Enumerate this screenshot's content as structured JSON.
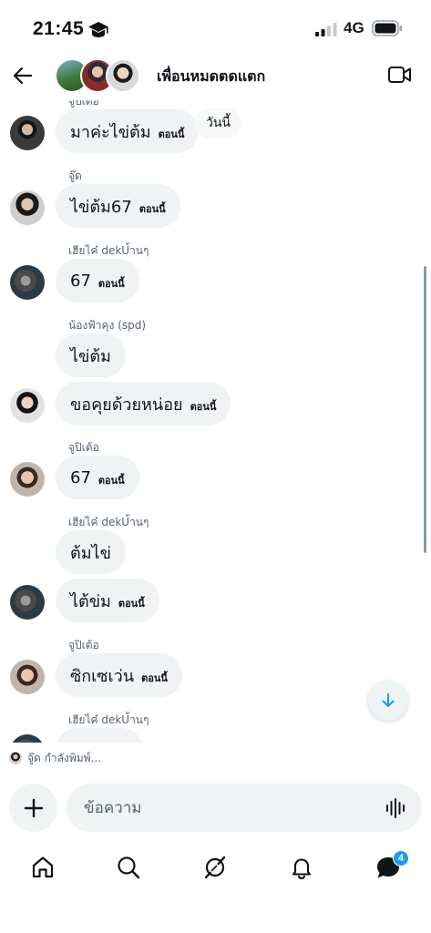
{
  "status_bar": {
    "time": "21:45",
    "network": "4G"
  },
  "header": {
    "group_name": "เพื่อนหมดตดแตก"
  },
  "messages": [
    {
      "sender": "จูปิเต้อ",
      "text": "มาค่ะไข่ต้ม",
      "time": "ตอนนี้",
      "reaction": "วันนี้"
    },
    {
      "sender": "จู๊ด",
      "text": "ไข่ต้ม67",
      "time": "ตอนนี้"
    },
    {
      "sender": "เฮียไค๋ dekU้านๆ",
      "text": "67",
      "time": "ตอนนี้"
    },
    {
      "sender": "น้องฟ้าคุง (spd)",
      "text": "ไข่ต้ม",
      "time": ""
    },
    {
      "sender": "",
      "text": "ขอคุยด้วยหน่อย",
      "time": "ตอนนี้"
    },
    {
      "sender": "จูปิเต้อ",
      "text": "67",
      "time": "ตอนนี้"
    },
    {
      "sender": "เฮียไค๋ dekU้านๆ",
      "text": "ต้มไข่",
      "time": ""
    },
    {
      "sender": "",
      "text": "ไต้ข่ม",
      "time": "ตอนนี้"
    },
    {
      "sender": "จูปิเต้อ",
      "text": "ซิกเซเว่น",
      "time": "ตอนนี้"
    },
    {
      "sender": "เฮียไค๋ dekU้านๆ",
      "text": "",
      "time": ""
    }
  ],
  "typing": {
    "text": "จู๊ด กำลังพิมพ์..."
  },
  "composer": {
    "placeholder": "ข้อความ"
  },
  "tabs": {
    "messages_badge": "4"
  },
  "colors": {
    "accent": "#1d9bf0",
    "bubble": "#eff3f4",
    "muted_text": "#536471"
  }
}
